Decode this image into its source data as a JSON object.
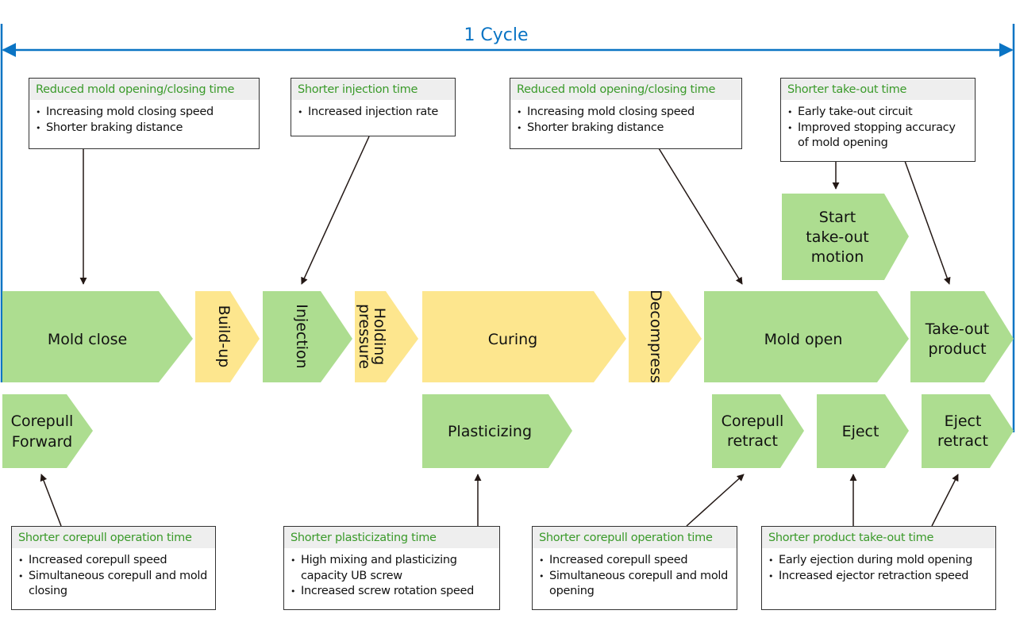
{
  "colors": {
    "cycle": "#0a74c4",
    "green_step": "#addd90",
    "yellow_step": "#fde68e",
    "box_heading": "#3a9a2a",
    "arrow": "#231815"
  },
  "cycle": {
    "label": "1 Cycle"
  },
  "steps": {
    "mold_close": {
      "label": "Mold close",
      "color": "green"
    },
    "build_up": {
      "label": "Build-up",
      "color": "yellow",
      "orientation": "vertical"
    },
    "injection": {
      "label": "Injection",
      "color": "green",
      "orientation": "vertical"
    },
    "holding_pressure": {
      "lines": [
        "Holding",
        "pressure"
      ],
      "color": "yellow",
      "orientation": "vertical"
    },
    "curing": {
      "label": "Curing",
      "color": "yellow"
    },
    "decompress": {
      "label": "Decompress",
      "color": "yellow",
      "orientation": "vertical"
    },
    "mold_open": {
      "label": "Mold open",
      "color": "green"
    },
    "take_out_product": {
      "lines": [
        "Take-out",
        "product"
      ],
      "color": "green"
    },
    "start_take_out_motion": {
      "lines": [
        "Start",
        "take-out",
        "motion"
      ],
      "color": "green"
    },
    "corepull_forward": {
      "lines": [
        "Corepull",
        "Forward"
      ],
      "color": "green"
    },
    "plasticizing": {
      "label": "Plasticizing",
      "color": "green"
    },
    "corepull_retract": {
      "lines": [
        "Corepull",
        "retract"
      ],
      "color": "green"
    },
    "eject": {
      "label": "Eject",
      "color": "green"
    },
    "eject_retract": {
      "lines": [
        "Eject",
        "retract"
      ],
      "color": "green"
    }
  },
  "boxes": {
    "mold_close_time": {
      "heading": "Reduced mold opening/closing time",
      "items": [
        "Increasing mold closing speed",
        "Shorter braking distance"
      ]
    },
    "injection_time": {
      "heading": "Shorter injection time",
      "items": [
        "Increased injection rate"
      ]
    },
    "mold_open_time": {
      "heading": "Reduced mold opening/closing time",
      "items": [
        "Increasing mold closing speed",
        "Shorter braking distance"
      ]
    },
    "take_out_time": {
      "heading": "Shorter take-out time",
      "items": [
        "Early take-out circuit",
        "Improved stopping accuracy of mold opening"
      ]
    },
    "corepull_forward_time": {
      "heading": "Shorter corepull operation time",
      "items": [
        "Increased corepull speed",
        "Simultaneous corepull and mold closing"
      ]
    },
    "plasticizing_time": {
      "heading": "Shorter plasticizating time",
      "items": [
        "High mixing and plasticizing capacity UB screw",
        "Increased screw rotation speed"
      ]
    },
    "corepull_retract_time": {
      "heading": "Shorter corepull operation time",
      "items": [
        "Increased corepull speed",
        "Simultaneous corepull and mold opening"
      ]
    },
    "product_take_out_time": {
      "heading": "Shorter product take-out time",
      "items": [
        "Early ejection during mold opening",
        "Increased ejector retraction speed"
      ]
    }
  }
}
